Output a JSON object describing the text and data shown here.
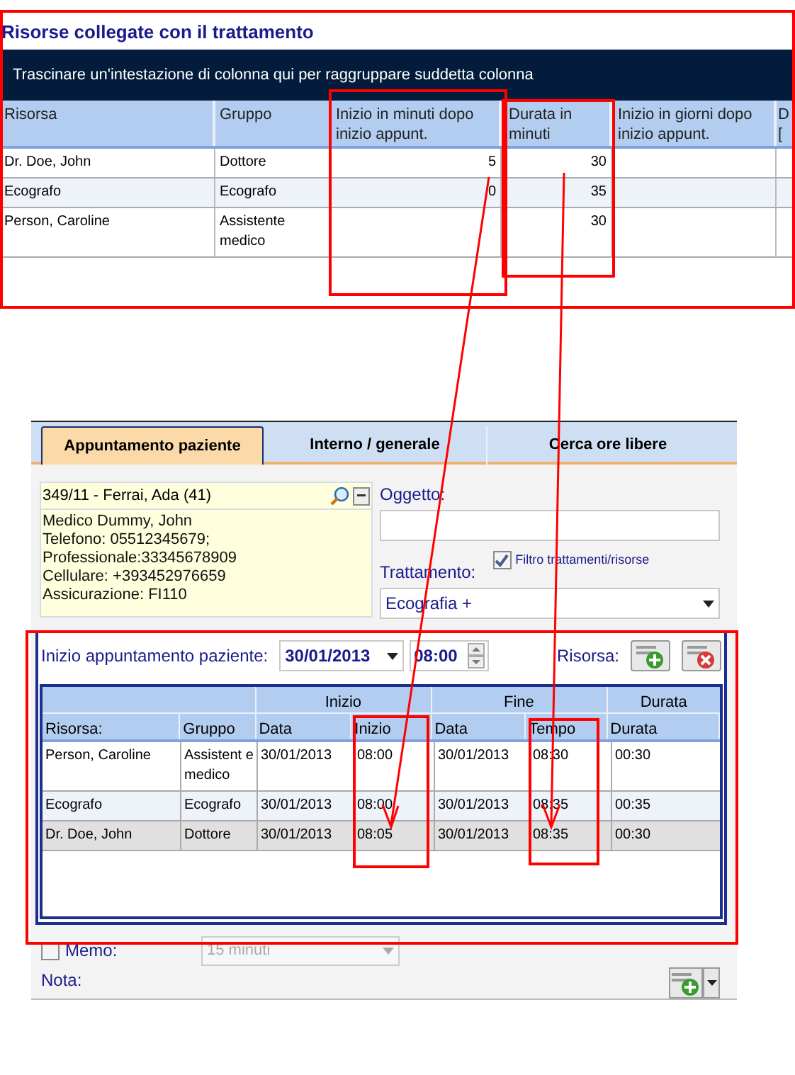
{
  "resource_panel": {
    "title": "Risorse collegate con il trattamento",
    "group_hint": "Trascinare un'intestazione di colonna qui per raggruppare suddetta colonna",
    "columns": [
      "Risorsa",
      "Gruppo",
      "Inizio in minuti dopo inizio appunt.",
      "Durata in minuti",
      "Inizio in giorni dopo inizio appunt.",
      "D ["
    ],
    "rows": [
      {
        "cells": [
          "Dr. Doe, John",
          "Dottore",
          "5",
          "30"
        ]
      },
      {
        "cells": [
          "Ecografo",
          "Ecografo",
          "0",
          "35"
        ]
      },
      {
        "cells": [
          "Person, Caroline",
          "Assistente medico",
          null,
          "30"
        ]
      }
    ]
  },
  "appointment_panel": {
    "tabs": [
      {
        "label": "Appuntamento paziente",
        "selected": true
      },
      {
        "label": "Interno / generale",
        "selected": false
      },
      {
        "label": "Cerca ore libere",
        "selected": false
      }
    ],
    "patient": {
      "header": "349/11 - Ferrai, Ada (41)",
      "lines": [
        "Medico Dummy, John",
        "Telefono:  05512345679;",
        "Professionale:33345678909",
        "Cellulare: +393452976659",
        "Assicurazione: FI110"
      ]
    },
    "subject": {
      "label": "Oggetto:"
    },
    "filter": {
      "label": "Filtro trattamenti/risorse",
      "checked": true
    },
    "treatment": {
      "label": "Trattamento:",
      "value": "Ecografia +"
    },
    "start": {
      "label": "Inizio appuntamento paziente:",
      "date": "30/01/2013",
      "time": "08:00",
      "resource_label": "Risorsa:"
    },
    "grid": {
      "groups": [
        "Inizio",
        "Fine",
        "Durata"
      ],
      "columns": [
        "Risorsa:",
        "Gruppo",
        "Data",
        "Inizio",
        "Data",
        "Tempo",
        "Durata"
      ],
      "rows": [
        {
          "selected": false,
          "cells": [
            "Person, Caroline",
            "Assistent e medico",
            "30/01/2013",
            "08:00",
            "30/01/2013",
            "08:30",
            "00:30"
          ]
        },
        {
          "selected": false,
          "cells": [
            "Ecografo",
            "Ecografo",
            "30/01/2013",
            "08:00",
            "30/01/2013",
            "08:35",
            "00:35"
          ]
        },
        {
          "selected": true,
          "cells": [
            "Dr. Doe, John",
            "Dottore",
            "30/01/2013",
            "08:05",
            "30/01/2013",
            "08:35",
            "00:30"
          ]
        }
      ]
    },
    "memo": {
      "label": "Memo:",
      "checked": false,
      "duration": "15 minuti",
      "duration_disabled": true
    },
    "note": {
      "label": "Nota:"
    }
  }
}
